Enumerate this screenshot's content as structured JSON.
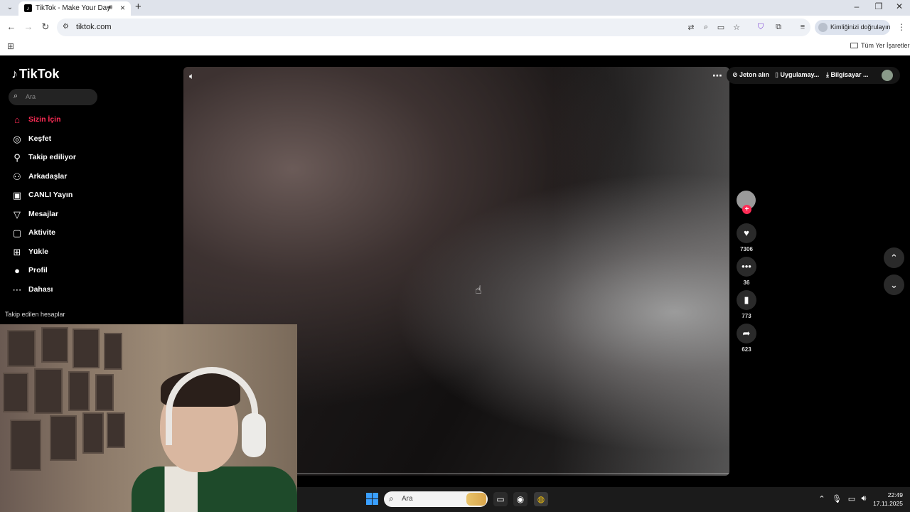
{
  "browser": {
    "tab_title": "TikTok - Make Your Day",
    "url": "tiktok.com",
    "profile_label": "Kimliğinizi doğrulayın",
    "bookmarks_all": "Tüm Yer İşaretleri"
  },
  "sidebar": {
    "logo": "TikTok",
    "search_placeholder": "Ara",
    "items": [
      {
        "label": "Sizin İçin",
        "icon": "home-icon"
      },
      {
        "label": "Keşfet",
        "icon": "compass-icon"
      },
      {
        "label": "Takip ediliyor",
        "icon": "user-follow-icon"
      },
      {
        "label": "Arkadaşlar",
        "icon": "friends-icon"
      },
      {
        "label": "CANLI Yayın",
        "icon": "live-icon"
      },
      {
        "label": "Mesajlar",
        "icon": "send-icon"
      },
      {
        "label": "Aktivite",
        "icon": "activity-icon"
      },
      {
        "label": "Yükle",
        "icon": "upload-icon"
      },
      {
        "label": "Profil",
        "icon": "profile-avatar-icon"
      },
      {
        "label": "Dahası",
        "icon": "more-icon"
      }
    ],
    "following_heading": "Takip edilen hesaplar"
  },
  "topbar": {
    "coins": "Jeton alın",
    "app": "Uygulamay...",
    "desktop": "Bilgisayar ..."
  },
  "video_actions": {
    "likes": "7306",
    "comments": "36",
    "saves": "773",
    "shares": "623"
  },
  "taskbar": {
    "search_placeholder": "Ara",
    "time": "22:49",
    "date": "17.11.2025"
  },
  "colors": {
    "accent": "#fe2c55",
    "page_bg": "#000000",
    "chrome_bg": "#dfe3eb"
  }
}
